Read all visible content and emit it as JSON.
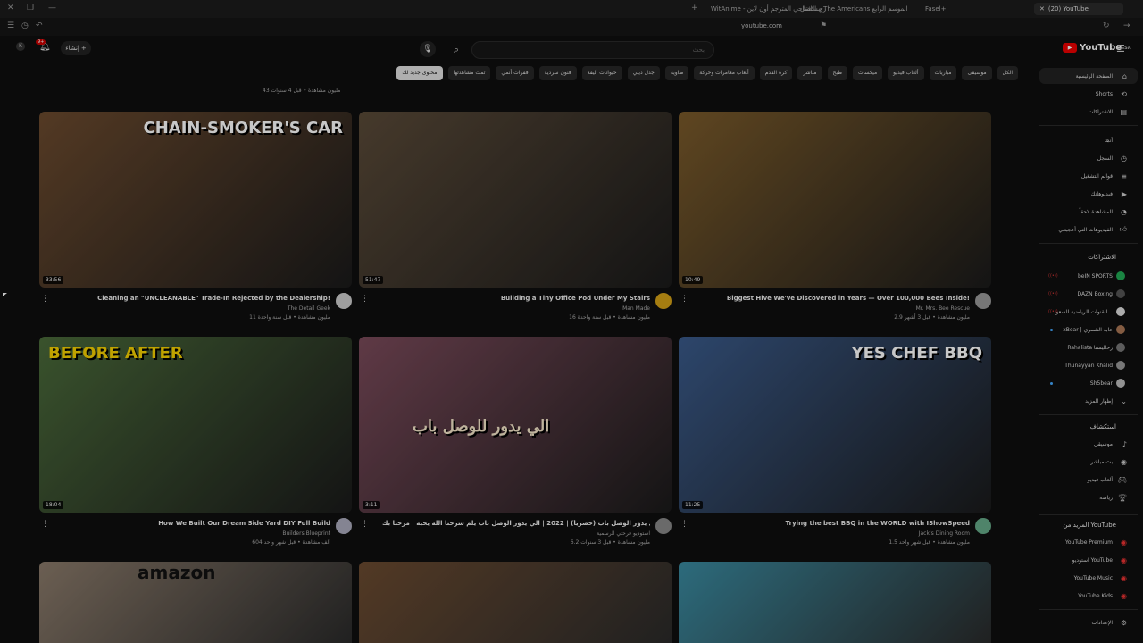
{
  "browser": {
    "tabs": [
      {
        "label": "Fasel+"
      },
      {
        "label": "مسلسل The Americans الموسم الرابع"
      },
      {
        "label": "WitAnime - ري الافتتاحي المترجم أون لاين"
      },
      {
        "label": "(20) YouTube"
      }
    ],
    "url": "youtube.com"
  },
  "header": {
    "search_placeholder": "بحث",
    "create_label": "إنشاء",
    "notif_count": "9+",
    "logo_text": "YouTube",
    "logo_region": "SA"
  },
  "chips": [
    "الكل",
    "موسيقى",
    "مباريات",
    "ألعاب فيديو",
    "ميكسات",
    "طبخ",
    "مباشر",
    "كرة القدم",
    "ألعاب مغامرات وحركة",
    "طاويه",
    "جدل ديني",
    "حيوانات أليفة",
    "فنون سردية",
    "فقرات أنمي",
    "تمت مشاهدتها",
    "محتوى جديد لك"
  ],
  "top_meta": "43 مليون مشاهدة • قبل 4 سنوات",
  "videos": [
    {
      "title": "Cleaning an \"UNCLEANABLE\" Trade-In Rejected by the Dealership!",
      "channel": "The Detail Geek",
      "meta": "11 مليون مشاهدة • قبل سنة واحدة",
      "duration": "33:56",
      "thumb_text": "CHAIN-SMOKER'S CAR",
      "thumb_color": "#6b4a2e",
      "avatar_color": "#ccc"
    },
    {
      "title": "Building a Tiny Office Pod Under My Stairs",
      "channel": "Man Made",
      "meta": "16 مليون مشاهدة • قبل سنة واحدة",
      "duration": "51:47",
      "thumb_text": "",
      "thumb_color": "#5a4a38",
      "avatar_color": "#d4a017"
    },
    {
      "title": "Biggest Hive We've Discovered in Years — Over 100,000 Bees Inside!",
      "channel": "Mr. Mrs. Bee Rescue",
      "meta": "2.9 مليون مشاهدة • قبل 3 أشهر",
      "duration": "10:49",
      "thumb_text": "",
      "thumb_color": "#7a5a2a",
      "avatar_color": "#999"
    },
    {
      "title": "How We Built Our Dream Side Yard DIY Full Build",
      "channel": "Builders Blueprint",
      "meta": "604 ألف مشاهدة • قبل شهر واحد",
      "duration": "18:04",
      "thumb_text": "BEFORE  AFTER",
      "thumb_color": "#4a6a3a",
      "avatar_color": "#aab"
    },
    {
      "title": "طاهر الجناني - الي يدور الوصل باب (حصرياً) | 2022 | الي يدور الوصل باب يلم سرحنا الله يحبه | مرحبا بك",
      "channel": "استوديو فرحتي الرسمية",
      "meta": "6.2 مليون مشاهدة • قبل 3 سنوات",
      "duration": "3:11",
      "thumb_text": "الي يدور للوصل باب",
      "thumb_color": "#7a4a5a",
      "avatar_color": "#888"
    },
    {
      "title": "Trying the best BBQ in the WORLD with IShowSpeed",
      "channel": "Jack's Dining Room",
      "meta": "1.5 مليون مشاهدة • قبل شهر واحد",
      "duration": "11:25",
      "thumb_text": "YES CHEF  BBQ",
      "thumb_color": "#3a5a8a",
      "avatar_color": "#6a8"
    }
  ],
  "row3": [
    {
      "thumb_text": "amazon",
      "thumb_color": "#8a7a6a"
    },
    {
      "thumb_text": "",
      "thumb_color": "#6a4a30"
    },
    {
      "thumb_text": "",
      "thumb_color": "#3a8aa0"
    }
  ],
  "sidebar": {
    "home": "الصفحة الرئيسية",
    "shorts": "Shorts",
    "subs": "الاشتراكات",
    "you_head": "أنت",
    "history": "السجل",
    "playlists": "قوائم التشغيل",
    "your_videos": "فيديوهاتك",
    "watch_later": "المشاهدة لاحقاً",
    "liked": "الفيديوهات التي أعجبتني",
    "subs_head": "الاشتراكات",
    "channels": [
      "beIN SPORTS",
      "DAZN Boxing",
      "القنوات الرياضية السعو...",
      "xBear | عابد الشمري",
      "Rahalista رحاليستا",
      "Thunayyan Khalid",
      "Sh5bear"
    ],
    "show_more": "إظهار المزيد",
    "explore_head": "استكشاف",
    "explore": [
      "موسيقى",
      "بث مباشر",
      "ألعاب فيديو",
      "رياضة"
    ],
    "more_head": "المزيد من YouTube",
    "more": [
      "YouTube Premium",
      "استوديو YouTube",
      "YouTube Music",
      "YouTube Kids"
    ],
    "settings": "الإعدادات"
  }
}
